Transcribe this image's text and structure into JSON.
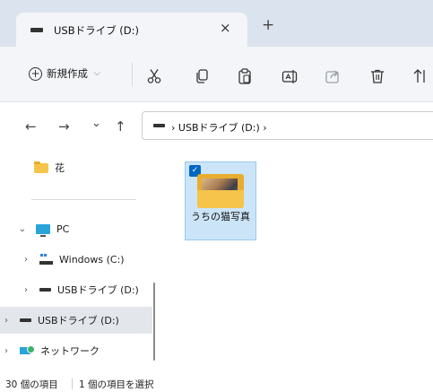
{
  "tab": {
    "title": "USBドライブ (D:)",
    "close": "×",
    "new_tab": "+"
  },
  "toolbar": {
    "new_label": "新規作成",
    "new_chevron": "⌵"
  },
  "nav": {
    "back": "←",
    "forward": "→",
    "recent": "⌄",
    "up": "↑"
  },
  "address": {
    "path": "USBドライブ (D:)",
    "sep": "›"
  },
  "navpane": {
    "quick": [
      {
        "label": "花",
        "icon": "folder-icon"
      }
    ],
    "items": [
      {
        "label": "PC",
        "chevron": "⌄",
        "icon": "pc-icon"
      },
      {
        "label": "Windows (C:)",
        "chevron": "›",
        "icon": "windows-drive-icon"
      },
      {
        "label": "USBドライブ (D:)",
        "chevron": "›",
        "icon": "usb-drive-icon"
      },
      {
        "label": "USBドライブ (D:)",
        "chevron": "›",
        "icon": "usb-drive-icon",
        "selected": true
      },
      {
        "label": "ネットワーク",
        "chevron": "›",
        "icon": "network-icon"
      }
    ]
  },
  "content": {
    "items": [
      {
        "name": "うちの猫写真",
        "type": "folder",
        "selected": true,
        "check": "✓"
      }
    ]
  },
  "status": {
    "count": "30 個の項目",
    "selection": "1 個の項目を選択"
  }
}
